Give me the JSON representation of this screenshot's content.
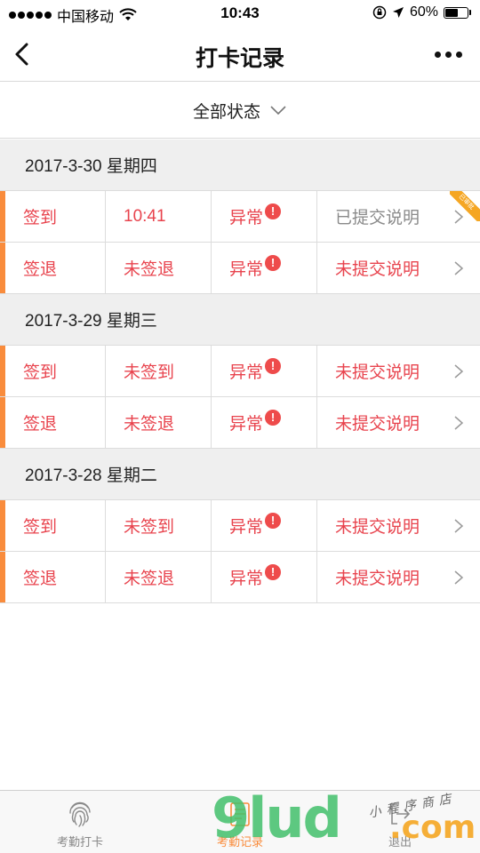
{
  "status_bar": {
    "carrier": "中国移动",
    "time": "10:43",
    "battery": "60%",
    "battery_level": 0.6
  },
  "nav": {
    "title": "打卡记录"
  },
  "filter": {
    "label": "全部状态"
  },
  "groups": [
    {
      "date": "2017-3-30  星期四",
      "rows": [
        {
          "type": "签到",
          "time": "10:41",
          "status": "异常",
          "note": "已提交说明",
          "note_submitted": true,
          "ribbon": "已审批"
        },
        {
          "type": "签退",
          "time": "未签退",
          "status": "异常",
          "note": "未提交说明",
          "note_submitted": false
        }
      ]
    },
    {
      "date": "2017-3-29  星期三",
      "rows": [
        {
          "type": "签到",
          "time": "未签到",
          "status": "异常",
          "note": "未提交说明",
          "note_submitted": false
        },
        {
          "type": "签退",
          "time": "未签退",
          "status": "异常",
          "note": "未提交说明",
          "note_submitted": false
        }
      ]
    },
    {
      "date": "2017-3-28  星期二",
      "rows": [
        {
          "type": "签到",
          "time": "未签到",
          "status": "异常",
          "note": "未提交说明",
          "note_submitted": false
        },
        {
          "type": "签退",
          "time": "未签退",
          "status": "异常",
          "note": "未提交说明",
          "note_submitted": false
        }
      ]
    }
  ],
  "tabs": [
    {
      "label": "考勤打卡",
      "icon": "fingerprint-icon",
      "active": false
    },
    {
      "label": "考勤记录",
      "icon": "record-icon",
      "active": true
    },
    {
      "label": "退出",
      "icon": "logout-icon",
      "active": false
    }
  ],
  "watermark": {
    "brand": "9lud",
    "domain": ".com",
    "slogan": "小程序商店"
  },
  "colors": {
    "accent": "#f98c3c",
    "error": "#e8434d",
    "muted": "#8a8a8a"
  }
}
